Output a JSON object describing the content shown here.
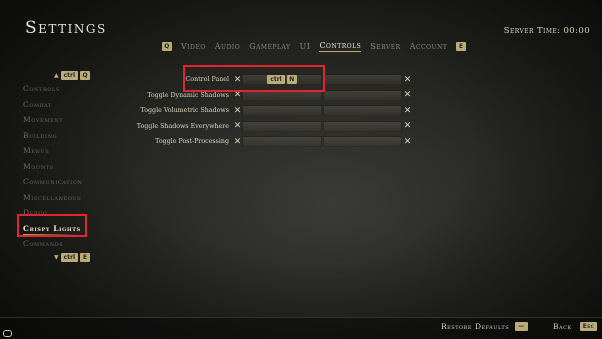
{
  "header": {
    "title": "Settings",
    "server_time": "Server Time: 00:00"
  },
  "tabs": {
    "prev_key": "Q",
    "next_key": "E",
    "items": [
      {
        "label": "Video"
      },
      {
        "label": "Audio"
      },
      {
        "label": "Gameplay"
      },
      {
        "label": "UI"
      },
      {
        "label": "Controls",
        "active": true
      },
      {
        "label": "Server"
      },
      {
        "label": "Account"
      }
    ]
  },
  "sidebar": {
    "up_keys": [
      "ctrl",
      "Q"
    ],
    "down_keys": [
      "ctrl",
      "E"
    ],
    "items": [
      {
        "label": "Controls"
      },
      {
        "label": "Combat"
      },
      {
        "label": "Movement"
      },
      {
        "label": "Building"
      },
      {
        "label": "Menus"
      },
      {
        "label": "Mounts"
      },
      {
        "label": "Communication"
      },
      {
        "label": "Miscellaneous"
      },
      {
        "label": "Debug"
      },
      {
        "label": "Crispy Lights",
        "active": true
      },
      {
        "label": "Commands"
      }
    ]
  },
  "bindings": [
    {
      "label": "Control Panel",
      "key_mod": "ctrl",
      "key": "N"
    },
    {
      "label": "Toggle Dynamic Shadows"
    },
    {
      "label": "Toggle Volumetric Shadows"
    },
    {
      "label": "Toggle Shadows Everywhere"
    },
    {
      "label": "Toggle Post-Processing"
    }
  ],
  "footer": {
    "restore_label": "Restore Defaults",
    "restore_key": "—",
    "back_label": "Back",
    "back_key": "Esc"
  },
  "icons": {
    "clear": "close-icon",
    "chat": "chat-bubble-icon"
  },
  "colors": {
    "accent": "#c7a95a",
    "highlight": "#e0252f",
    "keycap": "#b9ab7a"
  }
}
